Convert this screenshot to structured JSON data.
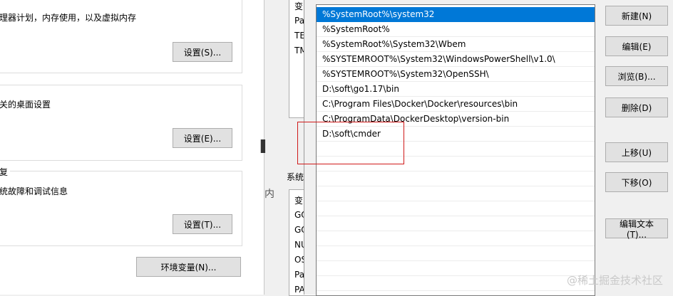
{
  "system_properties": {
    "performance": {
      "description": "理器计划，内存使用，以及虚拟内存",
      "settings_button": "设置(S)..."
    },
    "user_profiles": {
      "description": "关的桌面设置",
      "settings_button": "设置(E)..."
    },
    "startup_recovery": {
      "legend": "复",
      "description": "统故障和调试信息",
      "settings_button": "设置(T)..."
    },
    "env_vars_button": "环境变量(N)..."
  },
  "env_dialog": {
    "user_vars_header": "变",
    "user_vars": [
      "Pa",
      "TE",
      "TM"
    ],
    "big_glyph": "▌",
    "system_vars_label": "系统",
    "partial_text": "内",
    "system_vars_header": "变",
    "system_vars": [
      "GO",
      "GO",
      "NU",
      "OS",
      "Pa",
      "PA"
    ]
  },
  "edit_dialog": {
    "path_entries": [
      "%SystemRoot%\\system32",
      "%SystemRoot%",
      "%SystemRoot%\\System32\\Wbem",
      "%SYSTEMROOT%\\System32\\WindowsPowerShell\\v1.0\\",
      "%SYSTEMROOT%\\System32\\OpenSSH\\",
      "D:\\soft\\go1.17\\bin",
      "C:\\Program Files\\Docker\\Docker\\resources\\bin",
      "C:\\ProgramData\\DockerDesktop\\version-bin",
      "D:\\soft\\cmder"
    ],
    "selected_index": 0,
    "buttons": {
      "new": "新建(N)",
      "edit": "编辑(E)",
      "browse": "浏览(B)...",
      "delete": "删除(D)",
      "move_up": "上移(U)",
      "move_down": "下移(O)",
      "edit_text": "编辑文本(T)..."
    },
    "colors": {
      "selection": "#0078d7",
      "annotation": "#d01919"
    }
  },
  "watermark": "@稀土掘金技术社区"
}
